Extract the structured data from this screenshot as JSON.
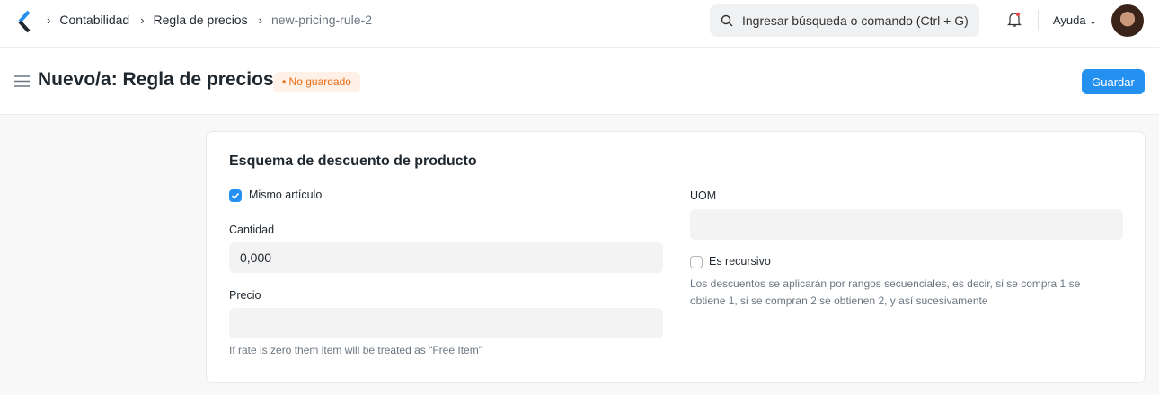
{
  "navbar": {
    "breadcrumbs": [
      "Contabilidad",
      "Regla de precios",
      "new-pricing-rule-2"
    ],
    "search_placeholder": "Ingresar búsqueda o comando (Ctrl + G)",
    "help_label": "Ayuda"
  },
  "header": {
    "title": "Nuevo/a: Regla de precios",
    "status": "No guardado",
    "save_label": "Guardar"
  },
  "section": {
    "title": "Esquema de descuento de producto",
    "same_item": {
      "label": "Mismo artículo",
      "checked": true
    },
    "qty": {
      "label": "Cantidad",
      "value": "0,000"
    },
    "rate": {
      "label": "Precio",
      "value": "",
      "help": "If rate is zero them item will be treated as \"Free Item\""
    },
    "uom": {
      "label": "UOM",
      "value": ""
    },
    "recursive": {
      "label": "Es recursivo",
      "checked": false,
      "help": "Los descuentos se aplicarán por rangos secuenciales, es decir, si se compra 1 se obtiene 1, si se compran 2 se obtienen 2, y así sucesivamente"
    }
  },
  "colors": {
    "primary": "#2490ef",
    "warning": "#e86c13"
  }
}
